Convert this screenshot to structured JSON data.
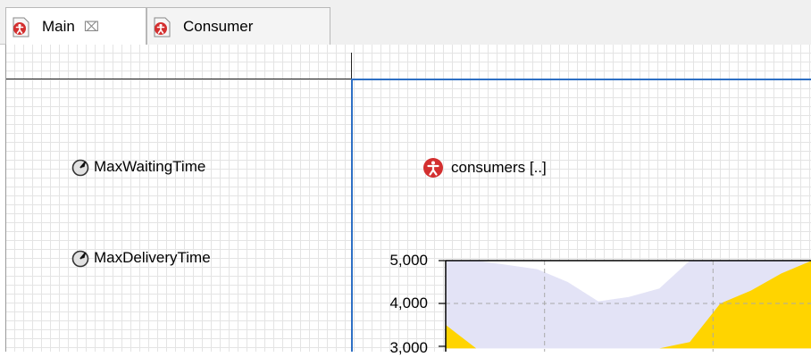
{
  "tabs": [
    {
      "label": "Main",
      "close_glyph": "⌧",
      "icon": "agent-type-icon",
      "active": true
    },
    {
      "label": "Consumer",
      "icon": "agent-type-icon",
      "active": false
    }
  ],
  "canvas": {
    "parameters": [
      {
        "label": "MaxWaitingTime",
        "icon": "parameter-gauge-icon"
      },
      {
        "label": "MaxDeliveryTime",
        "icon": "parameter-gauge-icon"
      }
    ],
    "agent_population": {
      "label": "consumers [..]",
      "icon": "agent-icon"
    }
  },
  "colors": {
    "frame_blue": "#2e6fc4",
    "agent_red": "#d32f2f",
    "chart_lavender": "#e3e3f6",
    "chart_yellow": "#ffd400",
    "grid_dashed": "#aaaaaa"
  },
  "chart_data": {
    "type": "area",
    "y_tick_labels": [
      "5,000",
      "4,000",
      "3,000"
    ],
    "y_visible_range": [
      2950,
      5000
    ],
    "x": [
      0,
      1,
      2,
      3,
      4,
      5,
      6,
      7,
      8,
      9,
      10,
      11,
      12
    ],
    "series": [
      {
        "color": "#e3e3f6",
        "values": [
          5000,
          5000,
          4900,
          4800,
          4500,
          4050,
          4150,
          4350,
          5000,
          5000,
          5000,
          5000,
          5000
        ]
      },
      {
        "color": "#ffd400",
        "values": [
          3500,
          2950,
          2950,
          2950,
          2950,
          2950,
          2950,
          2950,
          3100,
          4000,
          4300,
          4700,
          5000
        ]
      }
    ],
    "grid": "dashed"
  }
}
